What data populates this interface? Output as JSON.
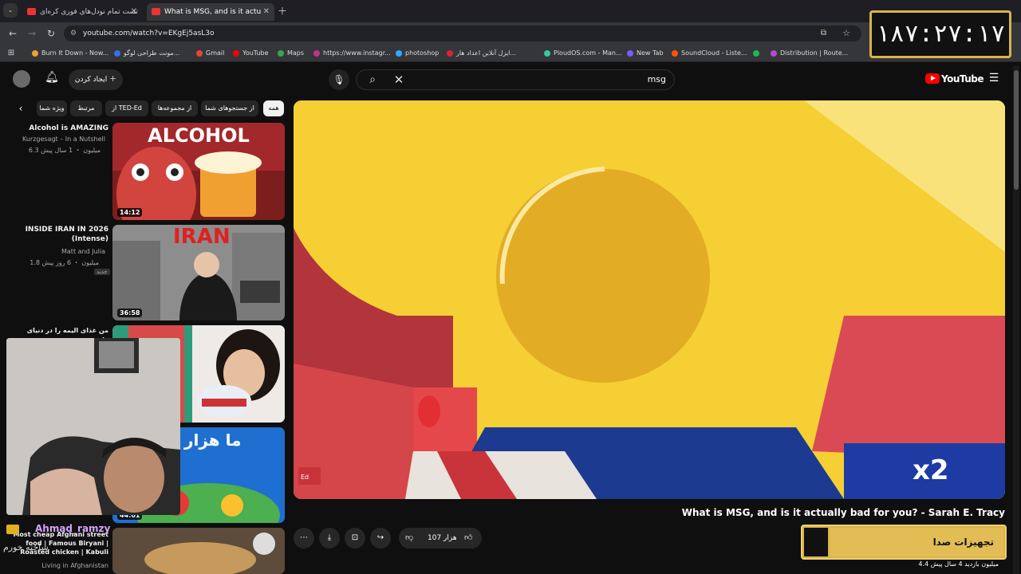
{
  "tabs": [
    {
      "title": "تست تمام نودل‌های فوری کره‌ای"
    },
    {
      "title": "What is MSG, and is it actu"
    }
  ],
  "address": {
    "url": "youtube.com/watch?v=EKgEj5asL3o"
  },
  "bookmarks": [
    {
      "label": "Burn It Down - Now...",
      "color": "#f0a030"
    },
    {
      "label": "مونت طراحی لوگو...",
      "color": "#3a6ee8"
    },
    {
      "label": "Gmail",
      "color": "#ea4335"
    },
    {
      "label": "YouTube",
      "color": "#ff0000"
    },
    {
      "label": "Maps",
      "color": "#34a853"
    },
    {
      "label": "https://www.instagr...",
      "color": "#c13584"
    },
    {
      "label": "photoshop",
      "color": "#31a8ff"
    },
    {
      "label": "ایزل آنلاین اعداد هار...",
      "color": "#d23"
    },
    {
      "label": "PloudOS.com - Man...",
      "color": "#3c9"
    },
    {
      "label": "New Tab",
      "color": "#7c5cff"
    },
    {
      "label": "SoundCloud - Liste...",
      "color": "#ff5500"
    },
    {
      "label": "",
      "color": "#1db954"
    },
    {
      "label": "Distribution | Route...",
      "color": "#b04bd6"
    }
  ],
  "clock": "۱۸۷:۲۷:۱۷",
  "header": {
    "search_value": "msg",
    "create_label": "ایجاد کردن",
    "logo_text": "YouTube",
    "colors": {
      "brand": "#ff0000",
      "bg": "#0f0f0f"
    }
  },
  "chips": [
    {
      "label": "همه"
    },
    {
      "label": "از جستجوهای شما"
    },
    {
      "label": "از مجموعه‌ها"
    },
    {
      "label": "از TED-Ed"
    },
    {
      "label": "مرتبط"
    },
    {
      "label": "ویژه شما"
    }
  ],
  "sidebar": [
    {
      "title": "Alcohol is AMAZING",
      "channel": "Kurzgesagt – In a Nutshell",
      "meta": "6.3 میلیون ・ 1 سال پیش",
      "duration": "14:12",
      "thumb_text": "ALCOHOL"
    },
    {
      "title": "INSIDE IRAN IN 2026 (Intense)",
      "channel": "Matt and Julia",
      "meta": "1.8 میلیون ・ 6 روز پیش",
      "badge": "جدید",
      "duration": "36:58",
      "thumb_text": "IRAN"
    },
    {
      "title": "من غذای الیمه را در دنیای واقعی",
      "duration": ""
    },
    {
      "title": "",
      "duration": "44:01",
      "thumb_text": "ما هزار"
    },
    {
      "title": "Most cheap Afghani street food | Famous Biryani | Roasted chicken | Kabuli",
      "channel": "Living in Afghanistan"
    }
  ],
  "player": {
    "watermark": "Ed",
    "speed_label": "x2"
  },
  "video": {
    "title": "What is MSG, and is it actually bad for you? - Sarah E. Tracy",
    "likes": "107 هزار",
    "views": "4.4 میلیون بازدید  4 سال پیش"
  },
  "overlay": {
    "streamer": "Ahmad_ramzy",
    "chat_line": "ساخته خورم",
    "audio_label": "تجهیزات صدا"
  }
}
